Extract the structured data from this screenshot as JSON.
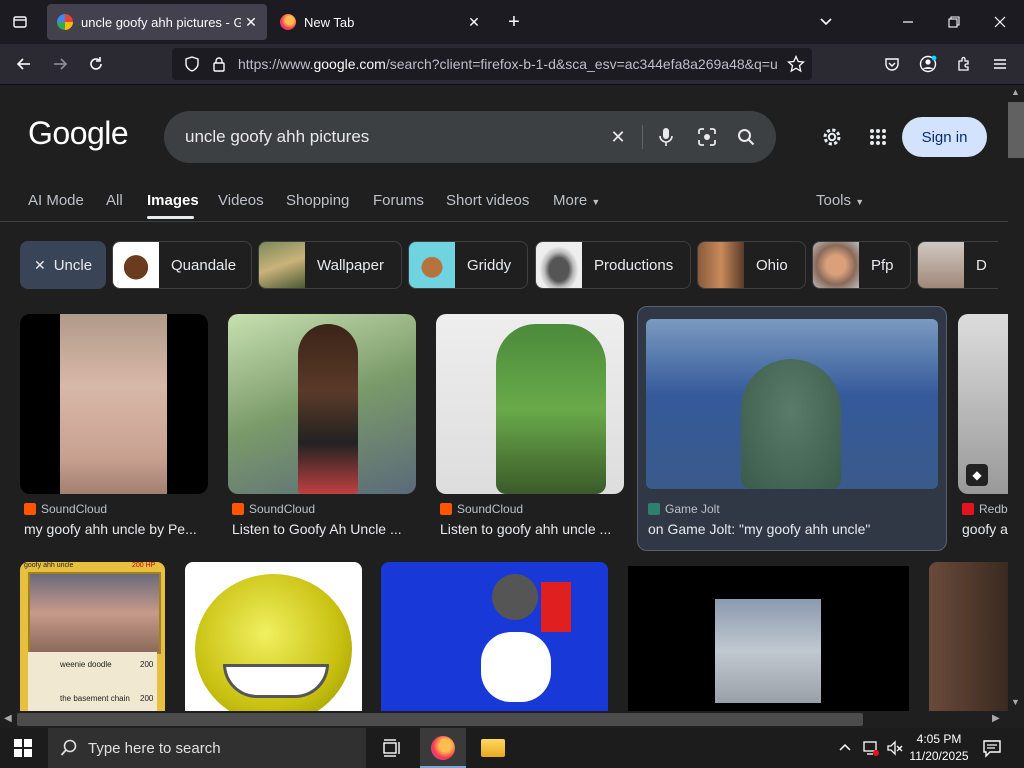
{
  "browser": {
    "tabs": [
      {
        "title": "uncle goofy ahh pictures - Goo",
        "active": true
      },
      {
        "title": "New Tab",
        "active": false
      }
    ],
    "url_prefix": "https://www.",
    "url_domain": "google.com",
    "url_rest": "/search?client=firefox-b-1-d&sca_esv=ac344efa8a269a48&q=u"
  },
  "google": {
    "logo": "Google",
    "query": "uncle goofy ahh pictures",
    "signin": "Sign in",
    "nav": [
      "AI Mode",
      "All",
      "Images",
      "Videos",
      "Shopping",
      "Forums",
      "Short videos",
      "More",
      "Tools"
    ],
    "chips": [
      "Uncle",
      "Quandale",
      "Wallpaper",
      "Griddy",
      "Productions",
      "Ohio",
      "Pfp",
      "D"
    ],
    "results_row1": [
      {
        "source": "SoundCloud",
        "caption": "my goofy ahh uncle by Pe..."
      },
      {
        "source": "SoundCloud",
        "caption": "Listen to Goofy Ah Uncle ..."
      },
      {
        "source": "SoundCloud",
        "caption": "Listen to goofy ahh uncle ..."
      },
      {
        "source": "Game Jolt",
        "caption": "on Game Jolt: \"my goofy ahh uncle\""
      },
      {
        "source": "Redb",
        "caption": "goofy a"
      }
    ],
    "card_text": {
      "title": "goofy ahh uncle",
      "hp": "200 HP",
      "move1": "weenie doodle",
      "move1_dmg": "200",
      "move2": "the basement chain",
      "move2_dmg": "200"
    }
  },
  "taskbar": {
    "search_placeholder": "Type here to search",
    "time": "4:05 PM",
    "date": "11/20/2025"
  },
  "colors": {
    "tab_bg": "#1c1b22",
    "nav_bg": "#2b2a33",
    "page_bg": "#1f1f1f",
    "signin_bg": "#d3e3fd",
    "chip_active": "#394457"
  }
}
